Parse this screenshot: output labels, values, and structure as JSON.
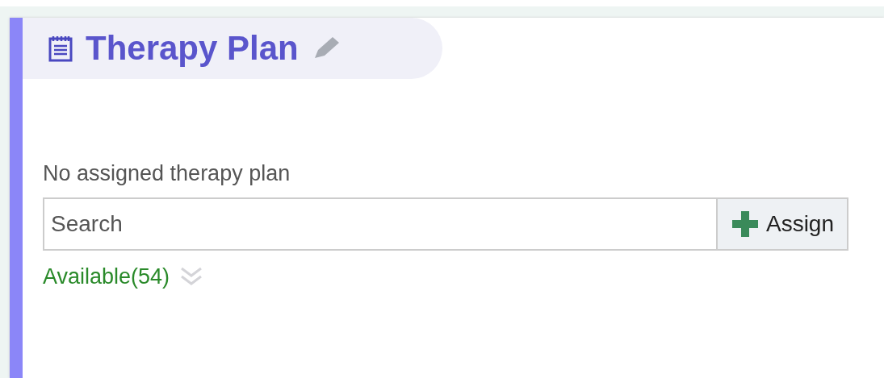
{
  "header": {
    "title": "Therapy Plan"
  },
  "status_text": "No assigned therapy plan",
  "search": {
    "placeholder": "Search"
  },
  "assign_button": {
    "label": "Assign"
  },
  "available": {
    "label": "Available(54)",
    "expanded": false
  }
}
